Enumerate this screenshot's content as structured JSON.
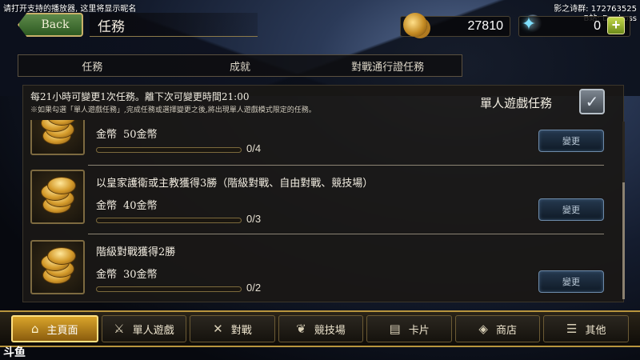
{
  "overlay": {
    "top_left": "请打开支持的播放器, 这里将显示昵名",
    "top_right_1": "影之诗群: 172763525",
    "top_right_2": "B站: Dogboss",
    "watermark": "斗鱼"
  },
  "header": {
    "back_label": "Back",
    "title": "任務",
    "coins": "27810",
    "crystals": "0",
    "plus_label": "+"
  },
  "tabs": [
    {
      "label": "任務",
      "active": true
    },
    {
      "label": "成就",
      "active": false
    },
    {
      "label": "對戰通行證任務",
      "active": false
    }
  ],
  "notice": {
    "line1": "每21小時可變更1次任務。離下次可變更時間21:00",
    "line2": "※如果勾選「單人遊戲任務」,完成任務或選擇變更之後,將出現單人遊戲模式限定的任務。",
    "solo_label": "單人遊戲任務",
    "solo_checked": true
  },
  "missions": [
    {
      "name": "",
      "reward_label": "金幣",
      "reward_amount": "50金幣",
      "progress": "0/4",
      "progress_fraction": 0,
      "change_label": "變更"
    },
    {
      "name": "以皇家護衛或主教獲得3勝（階級對戰、自由對戰、競技場）",
      "reward_label": "金幣",
      "reward_amount": "40金幣",
      "progress": "0/3",
      "progress_fraction": 0,
      "change_label": "變更"
    },
    {
      "name": "階級對戰獲得2勝",
      "reward_label": "金幣",
      "reward_amount": "30金幣",
      "progress": "0/2",
      "progress_fraction": 0,
      "change_label": "變更"
    }
  ],
  "bottom_nav": [
    {
      "label": "主頁面",
      "icon": "home-icon",
      "glyph": "⌂",
      "active": true
    },
    {
      "label": "單人遊戲",
      "icon": "swords-icon",
      "glyph": "⚔",
      "active": false
    },
    {
      "label": "對戰",
      "icon": "crossed-swords-icon",
      "glyph": "✕",
      "active": false
    },
    {
      "label": "競技場",
      "icon": "laurel-icon",
      "glyph": "❦",
      "active": false
    },
    {
      "label": "卡片",
      "icon": "cards-icon",
      "glyph": "▤",
      "active": false
    },
    {
      "label": "商店",
      "icon": "shop-icon",
      "glyph": "◈",
      "active": false
    },
    {
      "label": "其他",
      "icon": "other-icon",
      "glyph": "☰",
      "active": false
    }
  ]
}
